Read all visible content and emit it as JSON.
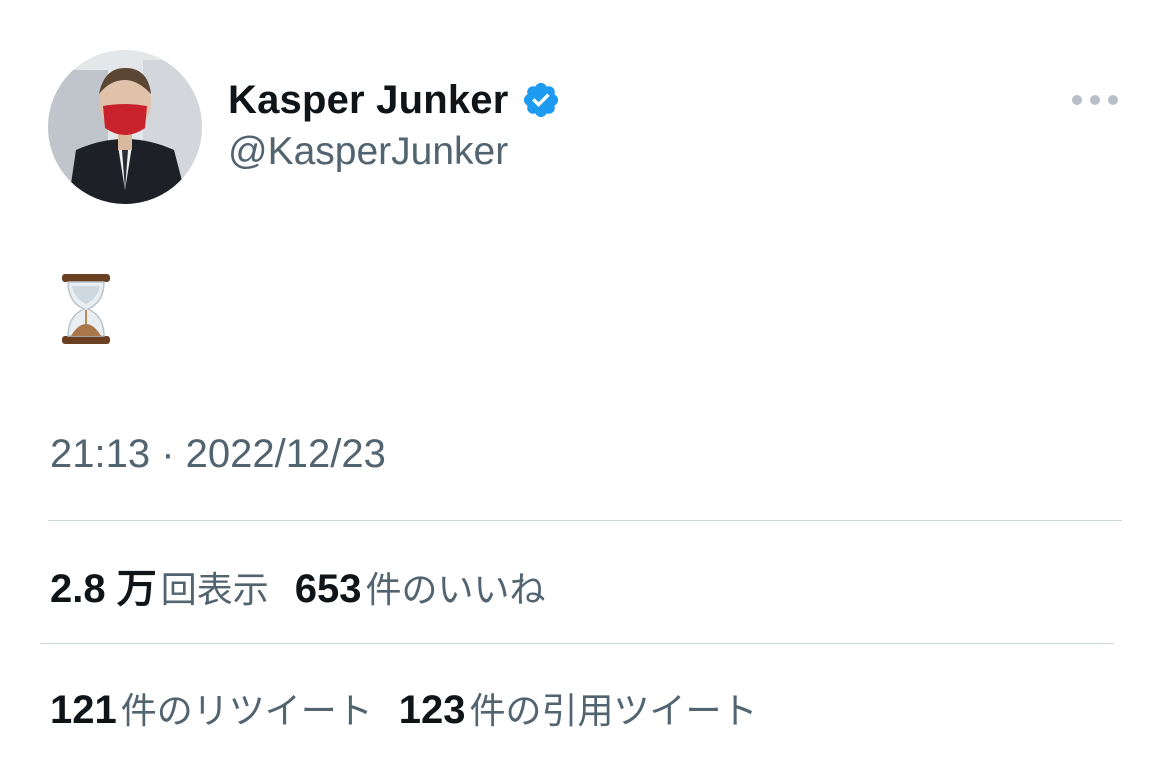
{
  "author": {
    "display_name": "Kasper Junker",
    "handle": "@KasperJunker",
    "verified": true,
    "avatar_icon": "profile-photo"
  },
  "tweet": {
    "text": "⏳",
    "emoji_icon": "hourglass-icon",
    "timestamp": "21:13 · 2022/12/23"
  },
  "stats": {
    "views": {
      "count": "2.8 万",
      "label": "回表示"
    },
    "likes": {
      "count": "653",
      "label": "件のいいね"
    },
    "retweets": {
      "count": "121",
      "label": "件のリツイート"
    },
    "quotes": {
      "count": "123",
      "label": "件の引用ツイート"
    }
  },
  "colors": {
    "text_primary": "#0f1419",
    "text_secondary": "#536471",
    "verified_blue": "#1d9bf0",
    "divider": "#cfd9de"
  }
}
